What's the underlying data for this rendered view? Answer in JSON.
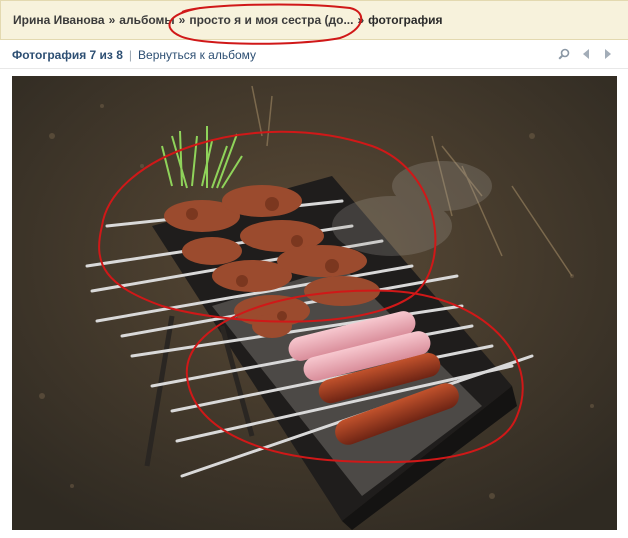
{
  "breadcrumb": {
    "user": "Ирина Иванова",
    "albums": "альбомы",
    "album": "просто я и моя сестра (до...",
    "current": "фотография",
    "separator": "»"
  },
  "photo_nav": {
    "counter": "Фотография 7 из 8",
    "divider": "|",
    "back_link": "Вернуться к альбому"
  },
  "toolbar_icons": [
    "search-icon",
    "prev-arrow-icon",
    "next-arrow-icon"
  ],
  "colors": {
    "breadcrumb_bg": "#f7f2dc",
    "link": "#2d4f73",
    "annotation_red": "#d01818"
  }
}
